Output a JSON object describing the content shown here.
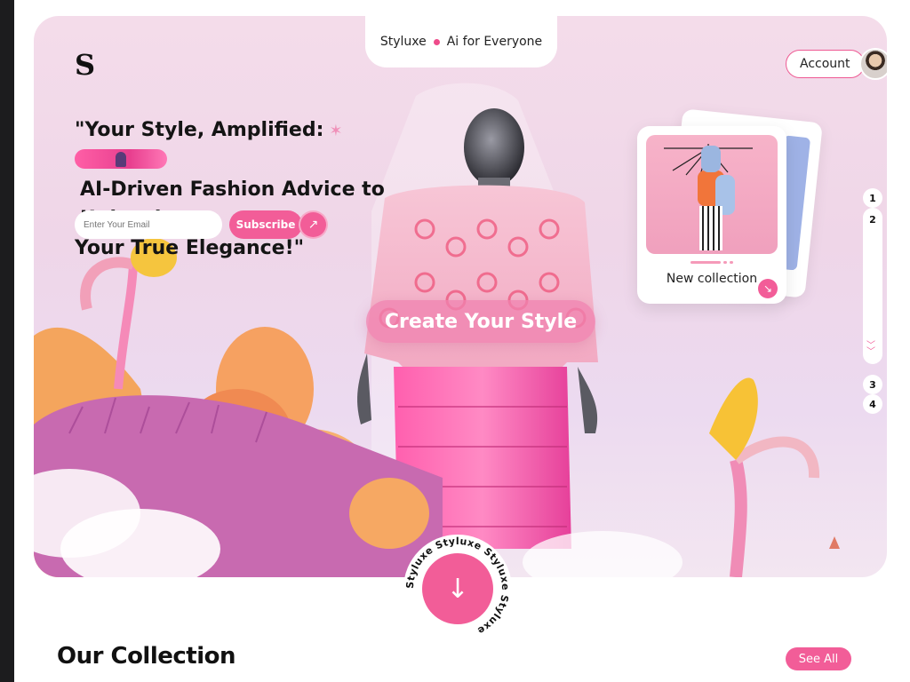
{
  "brand": {
    "logo_letter": "S",
    "name": "Styluxe",
    "tagline": "Ai for Everyone"
  },
  "header": {
    "account_label": "Account"
  },
  "hero": {
    "headline_line1": "\"Your Style, Amplified:",
    "headline_line2": "AI-Driven Fashion Advice to Unleash",
    "headline_line3": "Your True Elegance!\"",
    "email_placeholder": "Enter Your Email",
    "subscribe_label": "Subscribe",
    "cta_label": "Create Your Style"
  },
  "new_collection_card": {
    "label": "New collection"
  },
  "pager": {
    "pages": [
      "1",
      "2",
      "3",
      "4"
    ],
    "active": "2"
  },
  "badge": {
    "ring_text": "Styluxe Styluxe Styluxe Styluxe"
  },
  "collection": {
    "title": "Our Collection",
    "see_all_label": "See All"
  },
  "colors": {
    "accent_pink": "#f25d98",
    "hero_bg": "#efd6e8",
    "page_bg": "#ffffff",
    "frame_bg": "#1c1c1e"
  }
}
